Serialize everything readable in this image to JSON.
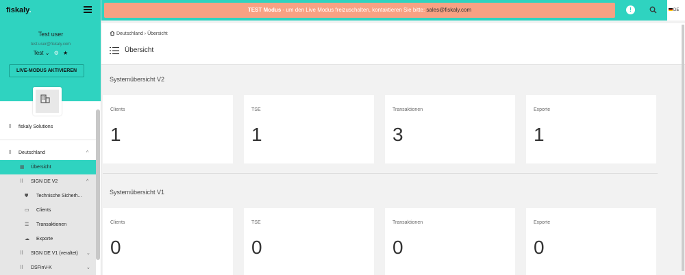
{
  "sidebar": {
    "logo": "fiskaly",
    "logo_dot": ".",
    "user_name": "Test user",
    "user_email": "test.user@fiskaly.com",
    "org_label": "Test",
    "live_button": "LIVE-MODUS AKTIVIEREN",
    "org_name": "fiskaly Solutions",
    "nav": {
      "deutschland": "Deutschland",
      "uebersicht": "Übersicht",
      "sign_de_v2": "SIGN DE V2",
      "tse": "Technische Sicherh...",
      "clients": "Clients",
      "transaktionen": "Transaktionen",
      "exporte": "Exporte",
      "sign_de_v1": "SIGN DE V1 (veraltet)",
      "dsfinvk": "DSFinV-K"
    }
  },
  "topbar": {
    "banner_bold": "TEST Modus",
    "banner_text": " - um den Live Modus freizuschalten, kontaktieren Sie bitte: ",
    "banner_email": "sales@fiskaly.com",
    "alert_glyph": "!",
    "language": "DE"
  },
  "header": {
    "breadcrumb": "Deutschland › Übersicht",
    "title": "Übersicht"
  },
  "sections": {
    "v2": {
      "title": "Systemübersicht V2",
      "cards": [
        {
          "label": "Clients",
          "value": "1"
        },
        {
          "label": "TSE",
          "value": "1"
        },
        {
          "label": "Transaktionen",
          "value": "3"
        },
        {
          "label": "Exporte",
          "value": "1"
        }
      ]
    },
    "v1": {
      "title": "Systemübersicht V1",
      "cards": [
        {
          "label": "Clients",
          "value": "0"
        },
        {
          "label": "TSE",
          "value": "0"
        },
        {
          "label": "Transaktionen",
          "value": "0"
        },
        {
          "label": "Exporte",
          "value": "0"
        }
      ]
    }
  },
  "colors": {
    "brand": "#2fd3c0",
    "banner": "#f8a183"
  },
  "icons": {
    "menu": "hamburger-icon",
    "alert": "alert-icon",
    "search": "search-icon",
    "home": "home-icon",
    "list": "list-icon"
  }
}
